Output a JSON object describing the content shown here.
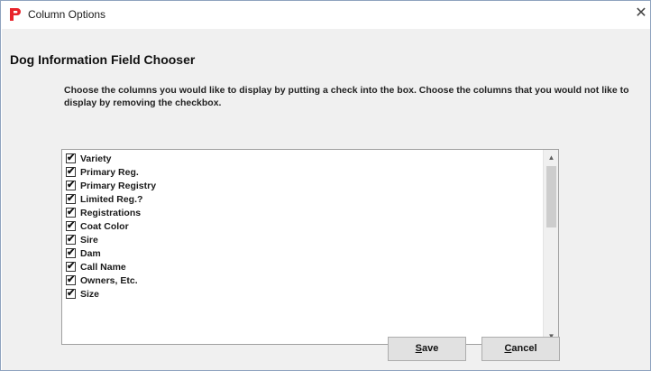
{
  "window": {
    "title": "Column Options",
    "close_glyph": "✕"
  },
  "dialog": {
    "heading": "Dog Information Field Chooser",
    "instructions": "Choose the columns you would like to display by putting a check into the box.  Choose the columns that you would not like to display by removing the checkbox."
  },
  "columns": [
    {
      "label": "Variety",
      "checked": true
    },
    {
      "label": "Primary Reg.",
      "checked": true
    },
    {
      "label": "Primary Registry",
      "checked": true
    },
    {
      "label": "Limited Reg.?",
      "checked": true
    },
    {
      "label": "Registrations",
      "checked": true
    },
    {
      "label": "Coat Color",
      "checked": true
    },
    {
      "label": "Sire",
      "checked": true
    },
    {
      "label": "Dam",
      "checked": true
    },
    {
      "label": "Call Name",
      "checked": true
    },
    {
      "label": "Owners, Etc.",
      "checked": true
    },
    {
      "label": "Size",
      "checked": true
    }
  ],
  "buttons": {
    "save_mnemonic": "S",
    "save_rest": "ave",
    "cancel_mnemonic": "C",
    "cancel_rest": "ancel"
  },
  "icons": {
    "app": "app-logo-icon",
    "close": "close-icon",
    "check": "checkmark-icon",
    "scroll_up": "scroll-up-arrow-icon",
    "scroll_down": "scroll-down-arrow-icon"
  },
  "colors": {
    "app_icon": "#e8242b",
    "client_background": "#f0f0f0",
    "button_face": "#e1e1e1"
  }
}
